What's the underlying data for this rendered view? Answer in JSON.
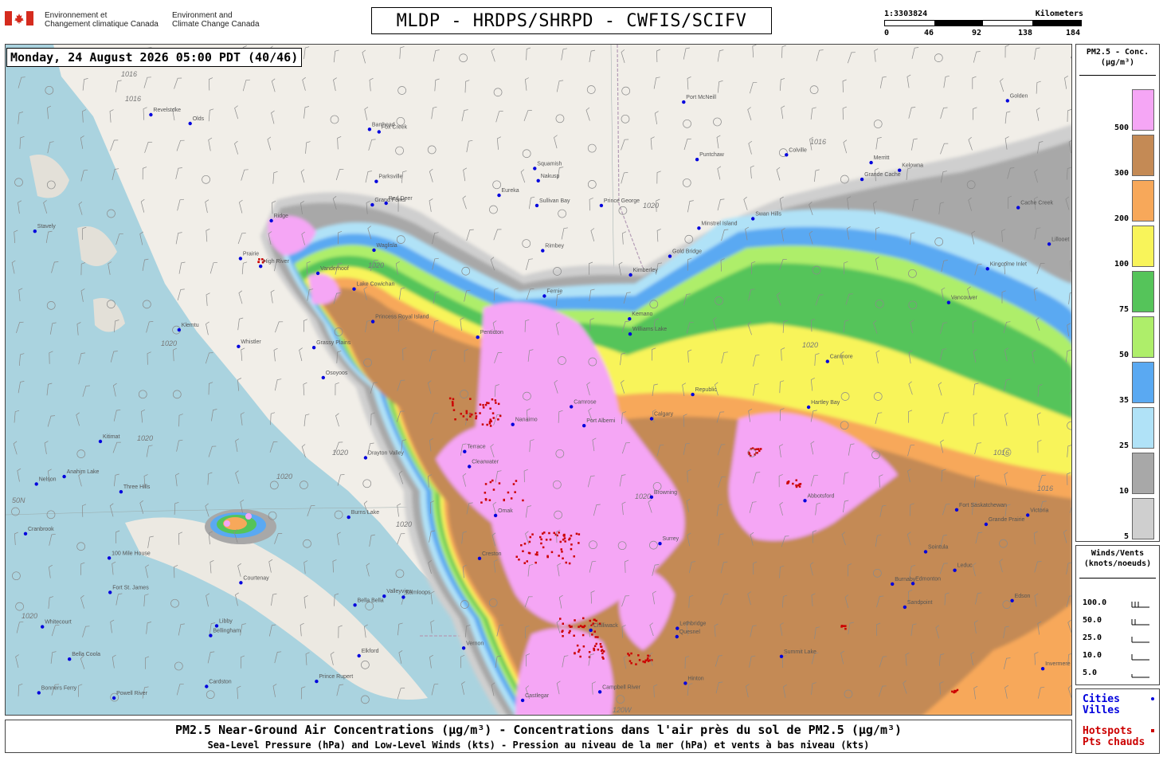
{
  "header": {
    "agency_fr": [
      "Environnement et",
      "Changement climatique Canada"
    ],
    "agency_en": [
      "Environment and",
      "Climate Change Canada"
    ],
    "title": "MLDP - HRDPS/SHRPD - CWFIS/SCIFV"
  },
  "scale": {
    "ratio": "1:3303824",
    "unit": "Kilometers",
    "ticks": [
      "0",
      "46",
      "92",
      "138",
      "184"
    ]
  },
  "timestamp": "Monday, 24 August 2026 05:00 PDT (40/46)",
  "legend_pm": {
    "title": "PM2.5 - Conc.",
    "unit": "(μg/m³)",
    "levels": [
      {
        "label": "500",
        "color": "#f5a6f5"
      },
      {
        "label": "300",
        "color": "#c48a55"
      },
      {
        "label": "200",
        "color": "#f7a85a"
      },
      {
        "label": "100",
        "color": "#f8f45a"
      },
      {
        "label": "75",
        "color": "#55c45a"
      },
      {
        "label": "50",
        "color": "#aeee6a"
      },
      {
        "label": "35",
        "color": "#5aa9f2"
      },
      {
        "label": "25",
        "color": "#b0e2f7"
      },
      {
        "label": "10",
        "color": "#a8a8a8"
      },
      {
        "label": "5",
        "color": "#cfcfcf"
      }
    ]
  },
  "legend_wind": {
    "title": "Winds/Vents",
    "unit": "(knots/noeuds)",
    "rows": [
      "100.0",
      "50.0",
      "25.0",
      "10.0",
      "5.0"
    ]
  },
  "legend_points": {
    "cities_en": "Cities",
    "cities_fr": "Villes",
    "hotspots_en": "Hotspots",
    "hotspots_fr": "Pts chauds",
    "city_color": "#0000dd",
    "hotspot_color": "#cc0000"
  },
  "footer": {
    "line1": "PM2.5 Near-Ground Air Concentrations (μg/m³) - Concentrations dans l'air près du sol de PM2.5 (μg/m³)",
    "line2": "Sea-Level Pressure (hPa) and Low-Level Winds (kts) - Pression au niveau de la mer (hPa) et vents à bas niveau (kts)"
  },
  "map_labels": {
    "cities": [
      "Prince Rupert",
      "Terrace",
      "Kitimat",
      "Burns Lake",
      "Fort St. James",
      "Vanderhoof",
      "Prince George",
      "Summit Lake",
      "Grande Prairie",
      "Valleyview",
      "Swan Hills",
      "Fox Creek",
      "Whitecourt",
      "Barrhead",
      "Edmonton",
      "Fort Saskatchewan",
      "Edson",
      "Grande Cache",
      "Drayton Valley",
      "Leduc",
      "Camrose",
      "Hinton",
      "Rimbey",
      "Red Deer",
      "Olds",
      "Three Hills",
      "Calgary",
      "High River",
      "Stavely",
      "Lethbridge",
      "Cardston",
      "Kemano",
      "Hartley Bay",
      "Princess Royal Island",
      "Klemtu",
      "Bella Bella",
      "Bella Coola",
      "Anahim Lake",
      "Puntchaw",
      "Quesnel",
      "Williams Lake",
      "100 Mile House",
      "Clearwater",
      "Revelstoke",
      "Golden",
      "Canmore",
      "Invermere",
      "Kimberley",
      "Cranbrook",
      "Fernie",
      "Elkford",
      "Creston",
      "Nelson",
      "Nakusp",
      "Vernon",
      "Kelowna",
      "Penticton",
      "Osoyoos",
      "Grand Forks",
      "Castlegar",
      "Kamloops",
      "Merritt",
      "Cache Creek",
      "Lillooet",
      "Gold Bridge",
      "Whistler",
      "Squamish",
      "Powell River",
      "Campbell River",
      "Courtenay",
      "Port Alberni",
      "Parksville",
      "Nanaimo",
      "Lake Cowichan",
      "Vancouver",
      "Surrey",
      "Abbotsford",
      "Chilliwack",
      "Victoria",
      "Bellingham",
      "Port McNeill",
      "Sointula",
      "Kingcome Inlet",
      "Sullivan Bay",
      "Minstrel Island",
      "Waglisla",
      "Omak",
      "Republic",
      "Colville",
      "Sandpoint",
      "Libby",
      "Eureka",
      "Bonners Ferry",
      "Browning",
      "Burnaby",
      "Grassy Plains",
      "Ridge",
      "Prairie"
    ],
    "isobars": [
      "1016",
      "1020"
    ],
    "graticule": [
      "50N",
      "120W"
    ]
  }
}
